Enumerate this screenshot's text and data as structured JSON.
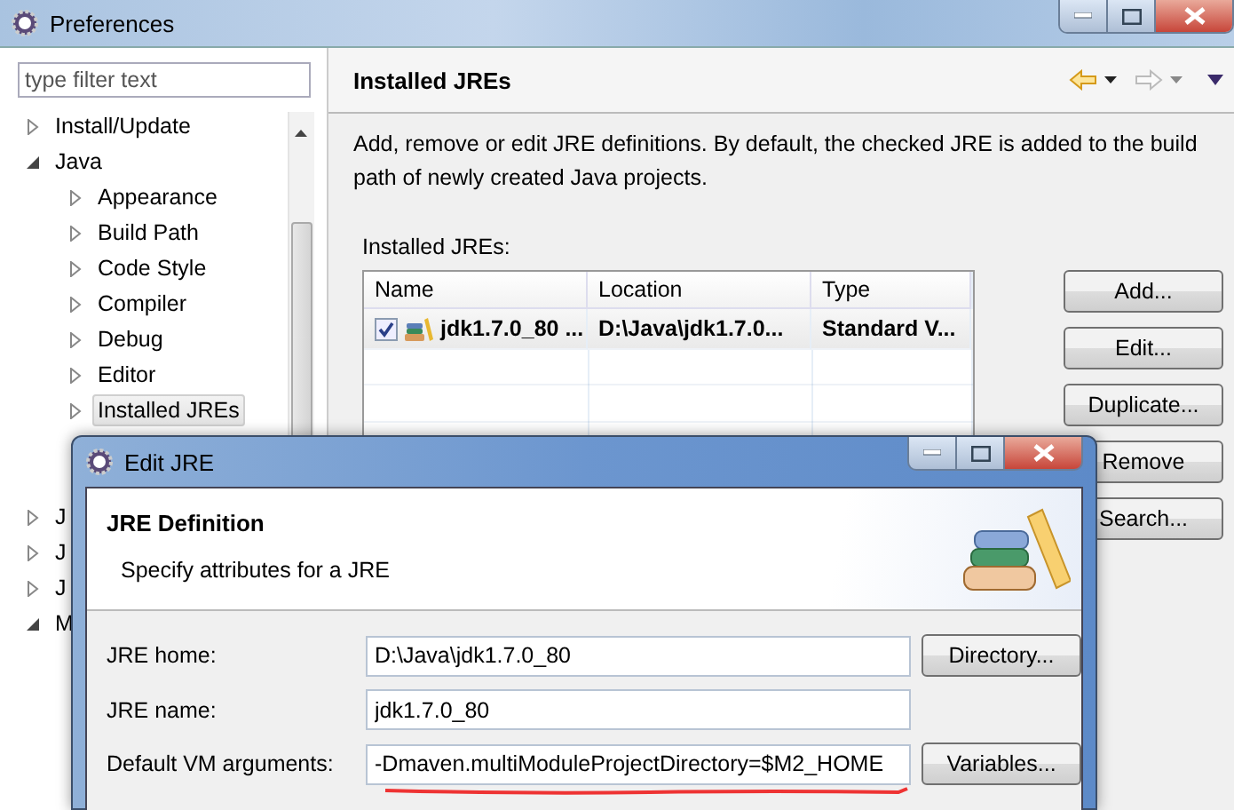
{
  "window": {
    "title": "Preferences"
  },
  "filter": {
    "placeholder": "type filter text"
  },
  "tree": [
    {
      "label": "Install/Update",
      "expanded": false,
      "selected": false
    },
    {
      "label": "Java",
      "expanded": true,
      "selected": false,
      "children": [
        {
          "label": "Appearance",
          "expanded": false,
          "selected": false
        },
        {
          "label": "Build Path",
          "expanded": false,
          "selected": false
        },
        {
          "label": "Code Style",
          "expanded": false,
          "selected": false
        },
        {
          "label": "Compiler",
          "expanded": false,
          "selected": false
        },
        {
          "label": "Debug",
          "expanded": false,
          "selected": false
        },
        {
          "label": "Editor",
          "expanded": false,
          "selected": false
        },
        {
          "label": "Installed JREs",
          "expanded": false,
          "selected": true
        }
      ]
    },
    {
      "label": "J",
      "expanded": false,
      "selected": false
    },
    {
      "label": "J",
      "expanded": false,
      "selected": false
    },
    {
      "label": "J",
      "expanded": false,
      "selected": false
    },
    {
      "label": "M",
      "expanded": true,
      "selected": false
    }
  ],
  "page": {
    "title": "Installed JREs",
    "description": "Add, remove or edit JRE definitions. By default, the checked JRE is added to the build path of newly created Java projects.",
    "table_label": "Installed JREs:"
  },
  "table": {
    "columns": [
      "Name",
      "Location",
      "Type"
    ],
    "rows": [
      {
        "checked": true,
        "cells": [
          "jdk1.7.0_80 ...",
          "D:\\Java\\jdk1.7.0...",
          "Standard V..."
        ]
      }
    ]
  },
  "side_buttons": [
    "Add...",
    "Edit...",
    "Duplicate...",
    "Remove",
    "Search..."
  ],
  "dialog": {
    "title": "Edit JRE",
    "heading": "JRE Definition",
    "subtitle": "Specify attributes for a JRE",
    "fields": [
      {
        "label": "JRE home:",
        "value": "D:\\Java\\jdk1.7.0_80",
        "button": "Directory..."
      },
      {
        "label": "JRE name:",
        "value": "jdk1.7.0_80"
      },
      {
        "label": "Default VM arguments:",
        "value": "-Dmaven.multiModuleProjectDirectory=$M2_HOME",
        "button": "Variables...",
        "underlined": true
      }
    ]
  }
}
